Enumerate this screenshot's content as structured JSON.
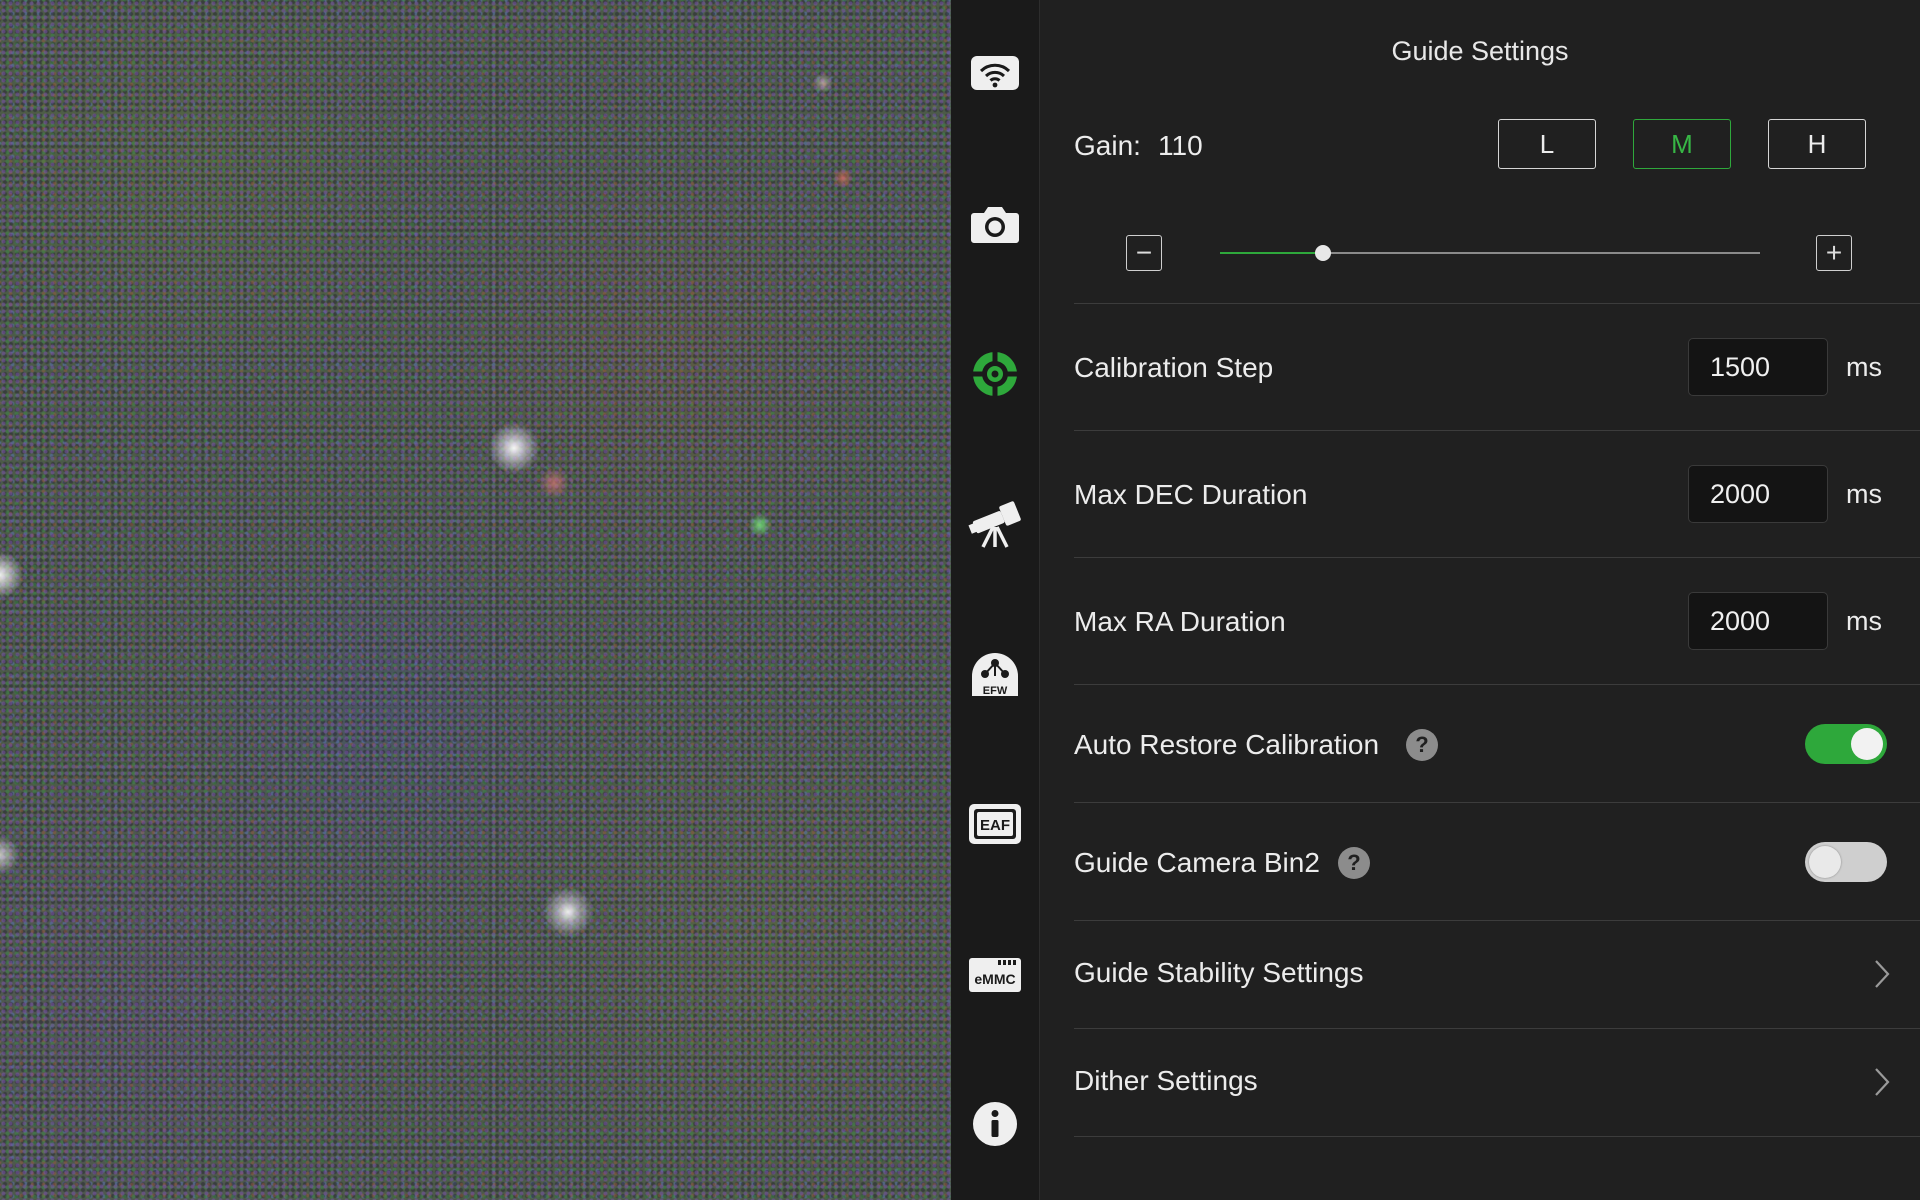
{
  "sidebar": {
    "items": [
      {
        "icon": "wifi-icon",
        "label": ""
      },
      {
        "icon": "camera-icon",
        "label": ""
      },
      {
        "icon": "guide-crosshair-icon",
        "label": "",
        "active": true
      },
      {
        "icon": "telescope-icon",
        "label": ""
      },
      {
        "icon": "filter-wheel-icon",
        "label": "EFW"
      },
      {
        "icon": "focuser-icon",
        "label": "EAF"
      },
      {
        "icon": "storage-icon",
        "label": "eMMC"
      },
      {
        "icon": "info-icon",
        "label": ""
      }
    ]
  },
  "panel": {
    "title": "Guide Settings",
    "gain": {
      "label": "Gain:",
      "value": "110",
      "presets": [
        "L",
        "M",
        "H"
      ],
      "selected": "M",
      "slider_fraction": 0.19,
      "decrement": "−",
      "increment": "+"
    },
    "fields": [
      {
        "label": "Calibration Step",
        "value": "1500",
        "unit": "ms"
      },
      {
        "label": "Max DEC Duration",
        "value": "2000",
        "unit": "ms"
      },
      {
        "label": "Max RA Duration",
        "value": "2000",
        "unit": "ms"
      }
    ],
    "toggles": [
      {
        "label": "Auto Restore Calibration",
        "help": "?",
        "on": true
      },
      {
        "label": "Guide Camera Bin2",
        "help": "?",
        "on": false
      }
    ],
    "links": [
      {
        "label": "Guide Stability Settings"
      },
      {
        "label": "Dither Settings"
      }
    ]
  },
  "colors": {
    "accent": "#2ea83b",
    "panel_bg": "#202020",
    "sidebar_bg": "#1a1a1a"
  }
}
